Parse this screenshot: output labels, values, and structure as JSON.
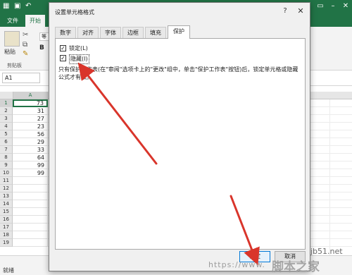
{
  "excel": {
    "title_partial": "工作簿1 - Excel",
    "ribbon_tabs": [
      "文件",
      "开始"
    ],
    "paste_label": "粘贴",
    "clipboard_label": "剪贴板",
    "font_partial": "等",
    "bold_label": "B",
    "name_box": "A1",
    "column_header": "A",
    "rows": [
      {
        "num": "1",
        "value": "73"
      },
      {
        "num": "2",
        "value": "31"
      },
      {
        "num": "3",
        "value": "27"
      },
      {
        "num": "4",
        "value": "23"
      },
      {
        "num": "5",
        "value": "56"
      },
      {
        "num": "6",
        "value": "29"
      },
      {
        "num": "7",
        "value": "33"
      },
      {
        "num": "8",
        "value": "64"
      },
      {
        "num": "9",
        "value": "99"
      },
      {
        "num": "10",
        "value": "99"
      },
      {
        "num": "11",
        "value": ""
      },
      {
        "num": "12",
        "value": ""
      },
      {
        "num": "13",
        "value": ""
      },
      {
        "num": "14",
        "value": ""
      },
      {
        "num": "15",
        "value": ""
      },
      {
        "num": "16",
        "value": ""
      },
      {
        "num": "17",
        "value": ""
      },
      {
        "num": "18",
        "value": ""
      },
      {
        "num": "19",
        "value": ""
      }
    ],
    "status_ready": "就绪"
  },
  "dialog": {
    "title": "设置单元格格式",
    "help_icon": "?",
    "close_icon": "✕",
    "tabs": [
      "数字",
      "对齐",
      "字体",
      "边框",
      "填充",
      "保护"
    ],
    "active_tab": "保护",
    "locked_label": "锁定(L)",
    "hidden_label": "隐藏(I)",
    "locked_checked": true,
    "hidden_checked": true,
    "description": "只有保护工作表(在\"审阅\"选项卡上的\"更改\"组中，单击\"保护工作表\"按钮)后，锁定单元格或隐藏公式才有效。",
    "ok_label": "确定",
    "cancel_label": "取消"
  },
  "watermark": {
    "site": "jb51.net",
    "url_partial": "https://www.",
    "brand_partial": "脚本之家"
  },
  "colors": {
    "excel_green": "#217346",
    "annotation_red": "#d9352b"
  }
}
